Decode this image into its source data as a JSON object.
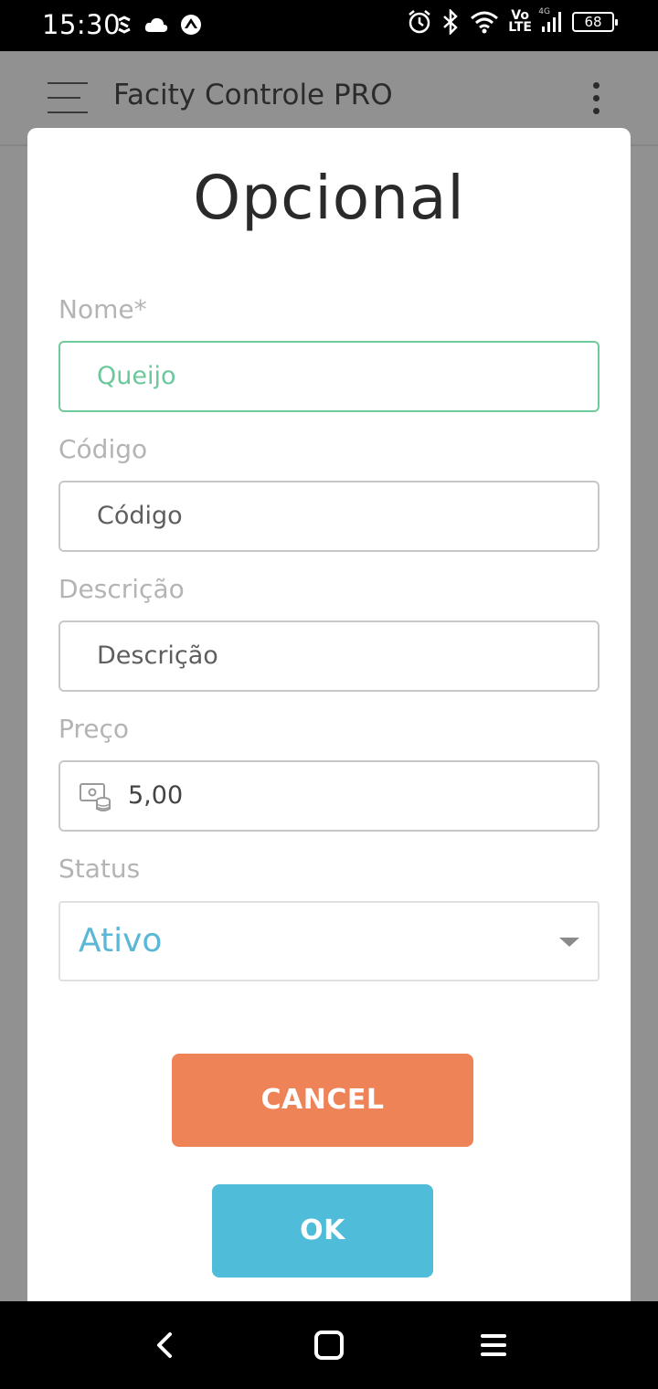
{
  "status_bar": {
    "time": "15:30",
    "network_top": "Vo",
    "network_bottom": "LTE",
    "network_type": "4G",
    "battery": "68",
    "icons": [
      "refresh-icon",
      "cloud-icon",
      "vpn-icon",
      "alarm-icon",
      "bluetooth-icon",
      "wifi-icon",
      "signal-icon",
      "battery-icon"
    ]
  },
  "app_bar": {
    "title": "Facity Controle PRO",
    "menu_icon": "hamburger-icon",
    "more_icon": "more-vert-icon"
  },
  "dialog": {
    "title": "Opcional",
    "fields": {
      "nome": {
        "label": "Nome*",
        "value": "Queijo"
      },
      "codigo": {
        "label": "Código",
        "placeholder": "Código"
      },
      "descricao": {
        "label": "Descrição",
        "placeholder": "Descrição"
      },
      "preco": {
        "label": "Preço",
        "value": "5,00",
        "icon": "money-icon"
      },
      "status": {
        "label": "Status",
        "value": "Ativo"
      }
    },
    "buttons": {
      "cancel": "CANCEL",
      "ok": "OK"
    },
    "colors": {
      "active_field": "#6fcb9a",
      "select_text": "#5ab8d6",
      "cancel_bg": "#ee8358",
      "ok_bg": "#4fbcd9"
    }
  },
  "nav_bar": {
    "icons": [
      "back-icon",
      "home-icon",
      "recents-icon"
    ]
  }
}
